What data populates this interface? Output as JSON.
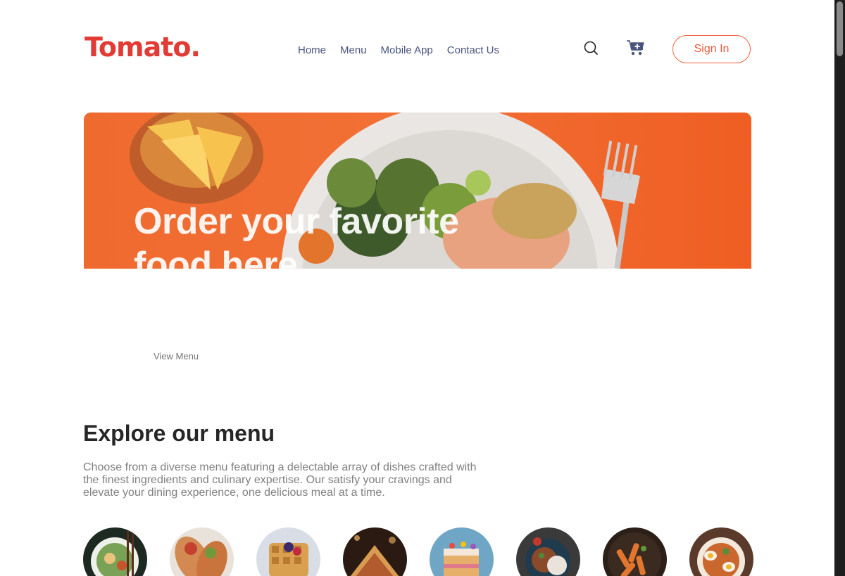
{
  "header": {
    "logo_text": "Tomato.",
    "nav": [
      "Home",
      "Menu",
      "Mobile App",
      "Contact Us"
    ],
    "signin_label": "Sign In",
    "accent_color": "#e23a34"
  },
  "hero": {
    "title": "Order your favorite food here",
    "cta_label": "View Menu"
  },
  "explore": {
    "title": "Explore our menu",
    "description": "Choose from a diverse menu featuring a delectable array of dishes crafted with the finest ingredients and culinary expertise. Our satisfy your cravings and elevate your dining experience, one delicious meal at a time."
  },
  "icons": {
    "search": "search-icon",
    "cart": "cart-icon"
  }
}
